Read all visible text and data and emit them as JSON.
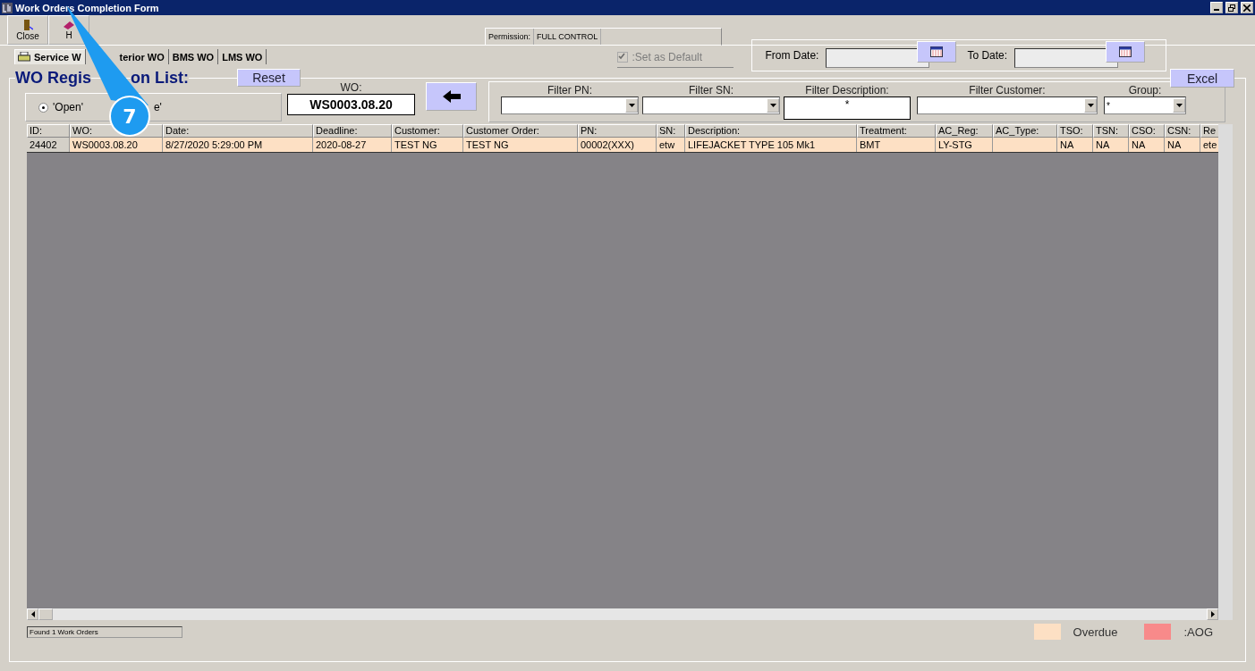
{
  "window": {
    "title": "Work Orders Completion Form"
  },
  "toolbar": [
    {
      "label": "Close"
    },
    {
      "label": "H"
    }
  ],
  "permission": {
    "label": "Permission:",
    "value": "FULL CONTROL"
  },
  "tabs": [
    {
      "label": "Service W",
      "selected": true
    },
    {
      "label": "terior WO",
      "selected": false
    },
    {
      "label": "BMS WO",
      "selected": false
    },
    {
      "label": "LMS WO",
      "selected": false
    }
  ],
  "set_default": {
    "label": ":Set as Default",
    "checked": true,
    "disabled": true
  },
  "dates": [
    {
      "label": "From Date:"
    },
    {
      "label": "To Date:"
    }
  ],
  "section": {
    "title_start": "WO Regis",
    "title_end": "on List:"
  },
  "reset_button": "Reset",
  "excel_button": "Excel",
  "status_radios": [
    {
      "label": "'Open'",
      "selected": true
    },
    {
      "label": "e'"
    }
  ],
  "wo": {
    "label": "WO:",
    "value": "WS0003.08.20"
  },
  "filters": [
    {
      "kind": "combo",
      "label": "Filter PN:"
    },
    {
      "kind": "combo",
      "label": "Filter SN:"
    },
    {
      "kind": "text",
      "label": "Filter Description:",
      "value": "*"
    },
    {
      "kind": "combo",
      "label": "Filter Customer:"
    },
    {
      "kind": "combo",
      "label": "Group:",
      "value": "*"
    }
  ],
  "table": {
    "columns": [
      "ID:",
      "WO:",
      "Date:",
      "Deadline:",
      "Customer:",
      "Customer Order:",
      "PN:",
      "SN:",
      "Description:",
      "Treatment:",
      "AC_Reg:",
      "AC_Type:",
      "TSO:",
      "TSN:",
      "CSO:",
      "CSN:",
      "Re"
    ],
    "rows": [
      {
        "color": "#fde0c4",
        "cells": [
          "24402",
          "WS0003.08.20",
          "8/27/2020 5:29:00 PM",
          "2020-08-27",
          "TEST NG",
          "TEST NG",
          "00002(XXX)",
          "etw",
          "LIFEJACKET TYPE 105 Mk1",
          "BMT",
          "LY-STG",
          "",
          "NA",
          "NA",
          "NA",
          "NA",
          "ete"
        ]
      }
    ]
  },
  "status_bar": "Found 1 Work Orders",
  "legend": [
    {
      "label": "Overdue",
      "color": "#fde0c4"
    },
    {
      "label": ":AOG",
      "color": "#f88a8a"
    }
  ],
  "callout": {
    "label": "7"
  }
}
